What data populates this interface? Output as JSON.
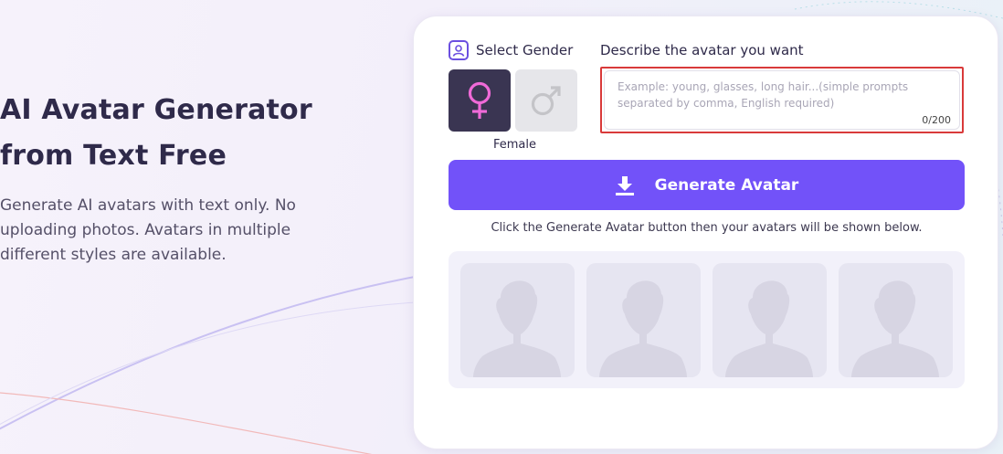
{
  "hero": {
    "title_line1": "AI Avatar Generator",
    "title_line2": "from Text Free",
    "description": "Generate AI avatars with text only. No uploading photos. Avatars in multiple different styles are available."
  },
  "form": {
    "gender_label": "Select Gender",
    "female_caption": "Female",
    "options": [
      {
        "name": "Female",
        "icon": "female-symbol-icon",
        "selected": true,
        "color": "#f06ad8"
      },
      {
        "name": "Male",
        "icon": "male-symbol-icon",
        "selected": false,
        "color": "#c4c4c8"
      }
    ],
    "describe_label": "Describe the avatar you want",
    "prompt_placeholder": "Example: young, glasses, long hair...(simple prompts separated by comma, English required)",
    "prompt_value": "",
    "counter": "0/200",
    "generate_label": "Generate Avatar",
    "hint": "Click the Generate Avatar button then your avatars will be shown below."
  },
  "gallery": {
    "placeholders": [
      "avatar-placeholder",
      "avatar-placeholder",
      "avatar-placeholder",
      "avatar-placeholder"
    ]
  },
  "colors": {
    "accent": "#7252f9",
    "female": "#f06ad8",
    "highlight_border": "#d93a3a"
  }
}
